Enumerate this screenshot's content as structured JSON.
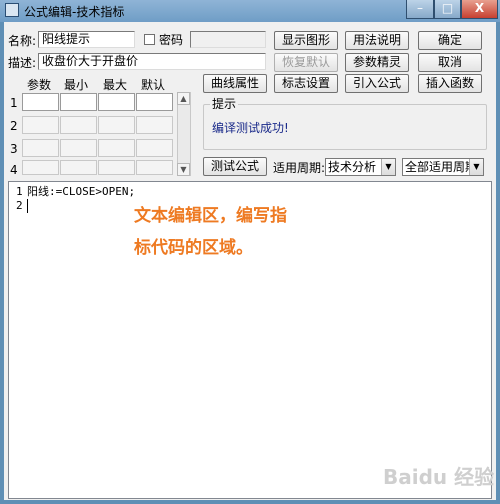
{
  "window": {
    "title": "公式编辑-技术指标",
    "minimize": "–",
    "maximize": "□",
    "close": "X"
  },
  "form": {
    "name_label": "名称:",
    "name_value": "阳线提示",
    "password_label": "密码",
    "desc_label": "描述:",
    "desc_value": "收盘价大于开盘价"
  },
  "buttons": {
    "show_graph": "显示图形",
    "usage": "用法说明",
    "confirm": "确定",
    "restore_default": "恢复默认",
    "param_wizard": "参数精灵",
    "cancel": "取消",
    "curve_props": "曲线属性",
    "flag_settings": "标志设置",
    "import_formula": "引入公式",
    "insert_function": "插入函数",
    "test_formula": "测试公式"
  },
  "params": {
    "headers": [
      "参数",
      "最小",
      "最大",
      "默认"
    ],
    "rows": [
      "1",
      "2",
      "3",
      "4"
    ]
  },
  "hint": {
    "title": "提示",
    "message": "编译测试成功!"
  },
  "period": {
    "label": "适用周期:",
    "type_value": "技术分析",
    "scope_value": "全部适用周期"
  },
  "editor": {
    "lines": [
      {
        "num": "1",
        "text": "阳线:=CLOSE>OPEN;"
      },
      {
        "num": "2",
        "text": ""
      }
    ],
    "annotation_line1": "文本编辑区，编写指",
    "annotation_line2": "标代码的区域。"
  },
  "watermark": "Baidu 经验"
}
